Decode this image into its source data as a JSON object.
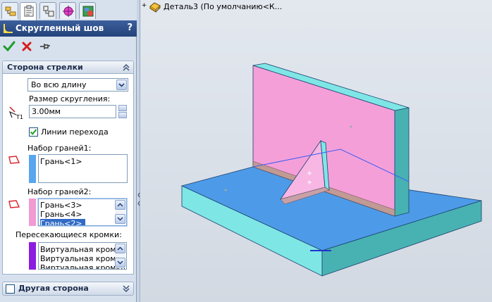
{
  "property_manager": {
    "title": "Скругленный шов",
    "help": "?",
    "tabs": [
      "feature-manager",
      "property-manager",
      "configuration-manager",
      "dimxpert-manager",
      "display-manager"
    ],
    "arrow_side": {
      "header": "Сторона стрелки",
      "extent_select": "Во всю длину",
      "fillet_size_label": "Размер скругления:",
      "fillet_size_value": "3.00мм",
      "tangent_prop_label": "Линии перехода",
      "tangent_prop_checked": true,
      "face_set1_label": "Набор граней1:",
      "face_set1_items": [
        "Грань<1>"
      ],
      "face_set2_label": "Набор граней2:",
      "face_set2_items": [
        "Грань<3>",
        "Грань<4>",
        "Грань<2>"
      ],
      "intersect_edges_label": "Пересекающиеся кромки:",
      "intersect_edges_items": [
        "Виртуальная кромка",
        "Виртуальная кромка",
        "Виртуальная кромка"
      ]
    },
    "other_side": {
      "header": "Другая сторона",
      "checked": false
    }
  },
  "graphics": {
    "tree_label": "Деталь3  (По умолчанию<К..."
  },
  "colors": {
    "accent_title": "#2a4a85",
    "set1_swatch": "#5aa6ee",
    "set2_swatch": "#f29ad2",
    "edges_swatch": "#8a1de0",
    "base_plate_top": "#4d9be8",
    "vertical_plate_front": "#f59fd9",
    "plate_edge": "#7fe6e6"
  }
}
